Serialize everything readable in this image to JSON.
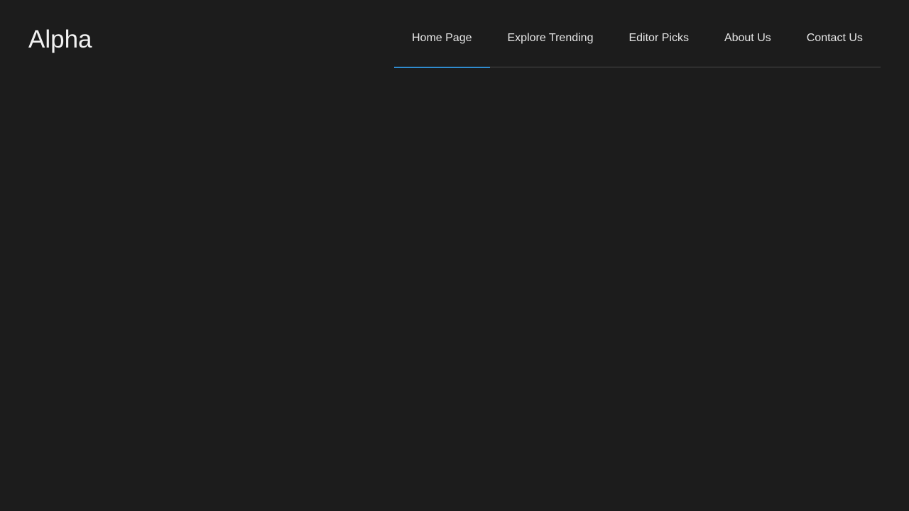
{
  "brand": {
    "name": "Alpha"
  },
  "nav": {
    "items": [
      {
        "label": "Home Page",
        "active": true
      },
      {
        "label": "Explore Trending",
        "active": false
      },
      {
        "label": "Editor Picks",
        "active": false
      },
      {
        "label": "About Us",
        "active": false
      },
      {
        "label": "Contact Us",
        "active": false
      }
    ]
  },
  "colors": {
    "background": "#1c1c1c",
    "accent": "#2f8ccf",
    "text": "#e6e6e6",
    "divider": "#4a4a4a"
  }
}
